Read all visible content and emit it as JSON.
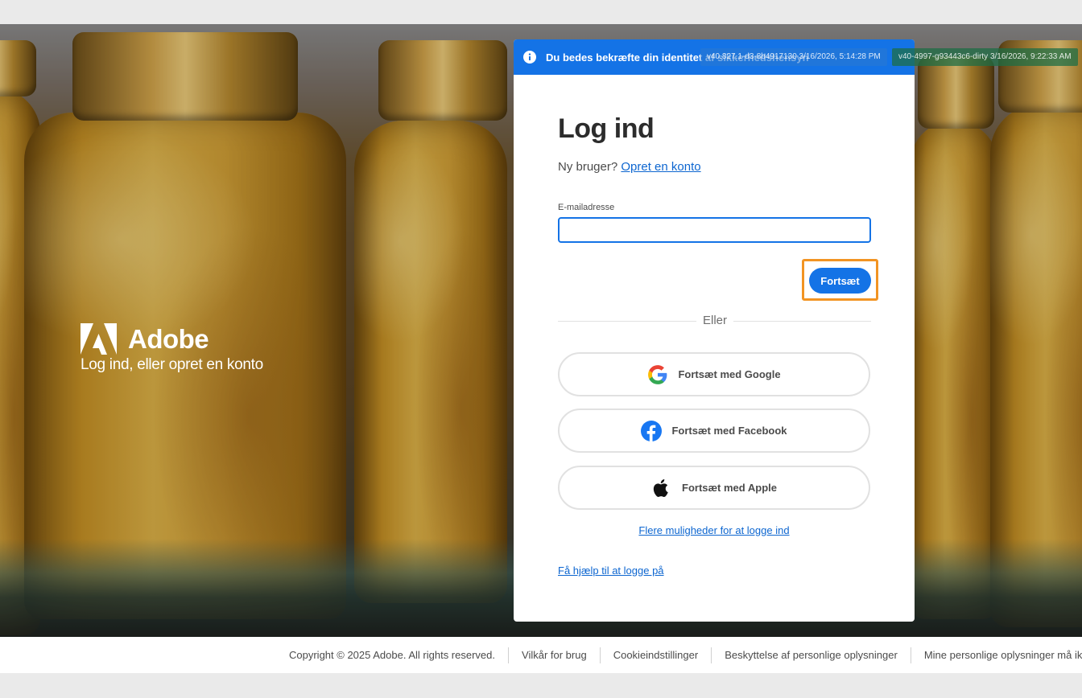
{
  "banner": {
    "text": "Du bedes bekræfte din identitet af sikkerhedshensyn",
    "version_1": "v40.827.1-d3-8b4917130 3/16/2026, 5:14:28 PM",
    "version_2": "v40-4997-g93443c6-dirty 3/16/2026, 9:22:33 AM"
  },
  "brand": {
    "name": "Adobe",
    "tagline": "Log ind, eller opret en konto"
  },
  "login": {
    "title": "Log ind",
    "new_user_prefix": "Ny bruger?",
    "create_account_link": "Opret en konto",
    "email_label": "E-mailadresse",
    "email_value": "",
    "continue_label": "Fortsæt",
    "divider_text": "Eller",
    "google_label": "Fortsæt med Google",
    "facebook_label": "Fortsæt med Facebook",
    "apple_label": "Fortsæt med Apple",
    "more_options_link": "Flere muligheder for at logge ind",
    "help_link": "Få hjælp til at logge på"
  },
  "footer": {
    "copyright": "Copyright © 2025 Adobe. All rights reserved.",
    "terms": "Vilkår for brug",
    "cookies": "Cookieindstillinger",
    "privacy": "Beskyttelse af personlige oplysninger",
    "do_not_sell": "Mine personlige oplysninger må ikke sælges"
  },
  "colors": {
    "accent": "#1473e6",
    "focus_ring": "#f29423",
    "link": "#0d66d0"
  },
  "icons": [
    "info-icon",
    "adobe-logo-icon",
    "google-icon",
    "facebook-icon",
    "apple-icon"
  ]
}
